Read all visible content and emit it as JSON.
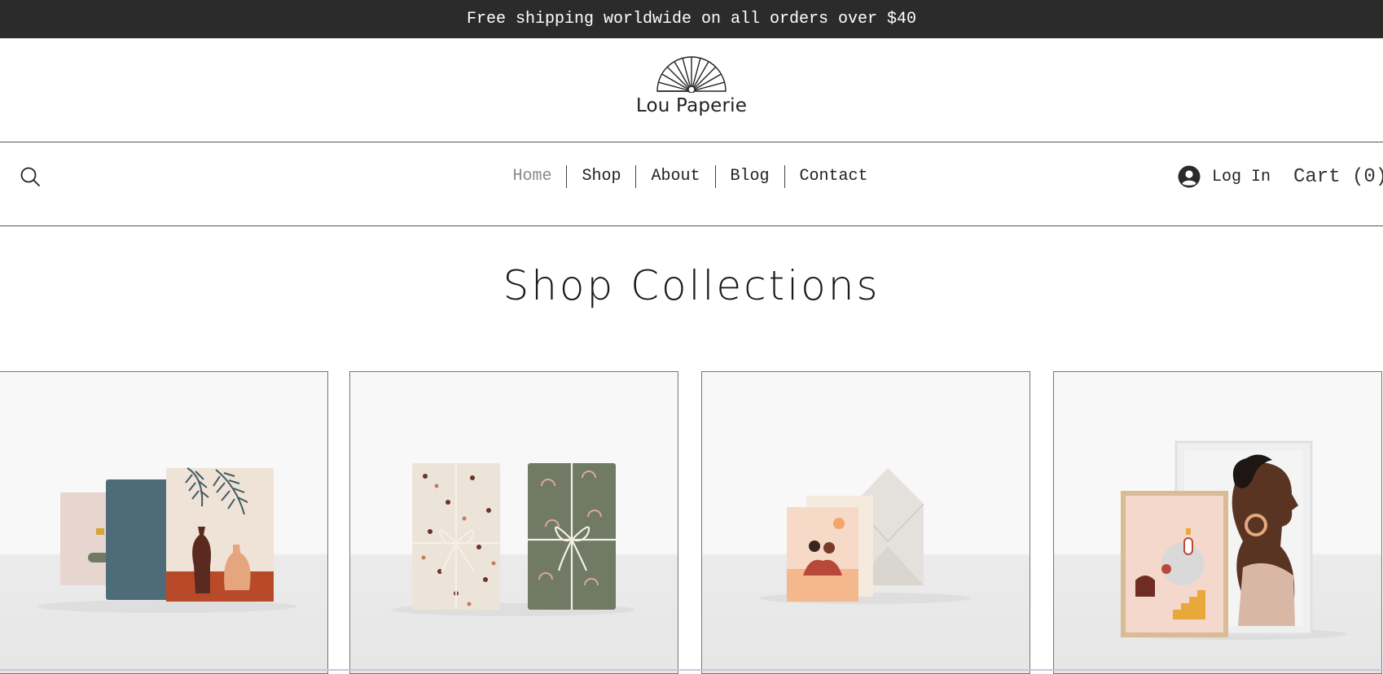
{
  "announcement": "Free shipping worldwide on all orders over $40",
  "brand": {
    "name": "Lou Paperie",
    "logo_icon": "fan-icon"
  },
  "nav": {
    "items": [
      {
        "label": "Home",
        "active": true
      },
      {
        "label": "Shop"
      },
      {
        "label": "About"
      },
      {
        "label": "Blog"
      },
      {
        "label": "Contact"
      }
    ]
  },
  "header": {
    "search_icon": "search-icon",
    "login_label": "Log In",
    "user_icon": "user-circle-icon",
    "cart_label": "Cart (0)"
  },
  "main": {
    "title": "Shop Collections",
    "collections": [
      {
        "image": "notebooks-illustration"
      },
      {
        "image": "gift-wrap-illustration"
      },
      {
        "image": "greeting-cards-illustration"
      },
      {
        "image": "art-prints-illustration"
      }
    ]
  },
  "colors": {
    "announcement_bg": "#2b2b2b",
    "nav_active": "#8a8a8a",
    "rule": "#555555"
  }
}
